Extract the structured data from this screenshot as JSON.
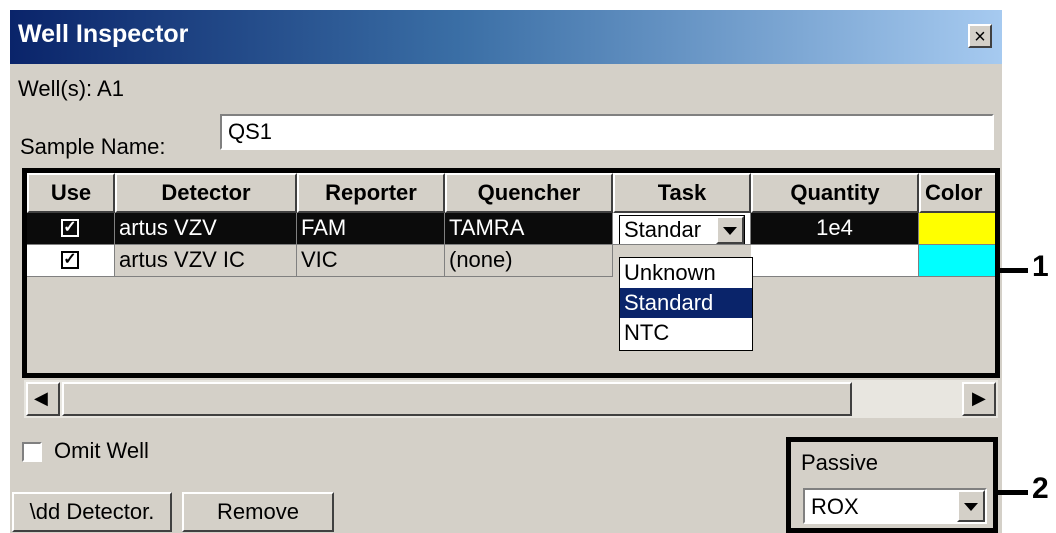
{
  "window": {
    "title": "Well Inspector",
    "close_label": "×"
  },
  "wells": "Well(s): A1",
  "sample": {
    "label": "Sample Name:",
    "value": "QS1"
  },
  "table": {
    "headers": [
      "Use",
      "Detector",
      "Reporter",
      "Quencher",
      "Task",
      "Quantity",
      "Color"
    ],
    "rows": [
      {
        "use": "true",
        "detector": "artus VZV",
        "reporter": "FAM",
        "quencher": "TAMRA",
        "task": "Standar",
        "quantity": "1e4",
        "color": "#ffff00"
      },
      {
        "use": "true",
        "detector": "artus VZV IC",
        "reporter": "VIC",
        "quencher": "(none)",
        "task": "",
        "quantity": "",
        "color": "#00ffff"
      }
    ],
    "task_options": [
      "Unknown",
      "Standard",
      "NTC"
    ],
    "task_selected": "Standard"
  },
  "omit_well": {
    "label": "Omit Well",
    "checked": "false"
  },
  "buttons": {
    "add_detector": "\\dd Detector.",
    "remove": "Remove"
  },
  "passive": {
    "label": "Passive",
    "value": "ROX"
  },
  "callouts": {
    "one": "1",
    "two": "2"
  },
  "icons": {
    "check": "✓",
    "scroll_left": "◀",
    "scroll_right": "▶"
  }
}
